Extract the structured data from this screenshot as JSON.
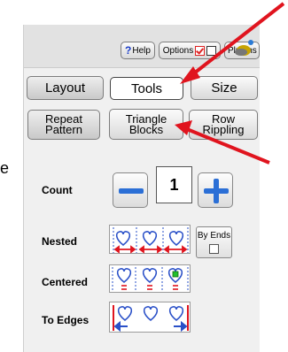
{
  "toolbar": {
    "help_label": "Help",
    "options_label": "Options",
    "plugins_label": "Plugins"
  },
  "main_tabs": [
    {
      "label": "Layout"
    },
    {
      "label": "Tools"
    },
    {
      "label": "Size"
    }
  ],
  "sub_tabs": [
    {
      "line1": "Repeat",
      "line2": "Pattern"
    },
    {
      "line1": "Triangle",
      "line2": "Blocks"
    },
    {
      "line1": "Row",
      "line2": "Rippling"
    }
  ],
  "count": {
    "label": "Count",
    "value": "1"
  },
  "rows": {
    "nested_label": "Nested",
    "by_ends_label": "By Ends",
    "centered_label": "Centered",
    "to_edges_label": "To Edges"
  },
  "colors": {
    "arrow": "#e0141e",
    "accent_blue": "#2b6fd6",
    "icon_heart": "#2a50c8"
  },
  "partial_text": "e"
}
